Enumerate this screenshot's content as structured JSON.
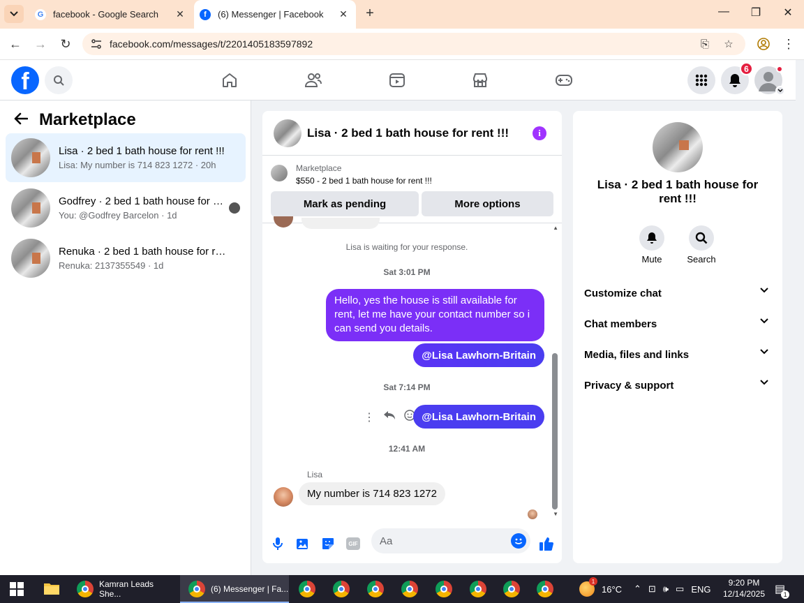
{
  "browser": {
    "tabs": [
      {
        "title": "facebook - Google Search",
        "icon": "google-icon"
      },
      {
        "title": "(6) Messenger | Facebook",
        "icon": "facebook-icon"
      }
    ],
    "url": "facebook.com/messages/t/2201405183597892"
  },
  "fb": {
    "logo_letter": "f",
    "notifications_count": "6"
  },
  "left": {
    "title": "Marketplace",
    "conversations": [
      {
        "name": "Lisa · 2 bed 1 bath house for rent !!!",
        "preview": "Lisa: My number is 714 823 1272 · 20h"
      },
      {
        "name": "Godfrey · 2 bed 1 bath house for rent !!!",
        "preview": "You: @Godfrey Barcelon · 1d"
      },
      {
        "name": "Renuka · 2 bed 1 bath house for rent !!!",
        "preview": "Renuka: 2137355549 · 1d"
      }
    ]
  },
  "chat": {
    "title": "Lisa · 2 bed 1 bath house for rent !!!",
    "info_glyph": "i",
    "listing_label": "Marketplace",
    "listing_title": "$550 - 2 bed 1 bath house for rent !!!",
    "mark_pending": "Mark as pending",
    "more_options": "More options",
    "waiting_text": "Lisa is waiting for your response.",
    "time1": "Sat 3:01 PM",
    "msg_out_1": "Hello, yes the house is still available for rent, let me have your contact number so i can send you details.",
    "msg_out_2": "@Lisa Lawhorn-Britain",
    "time2": "Sat 7:14 PM",
    "msg_out_3": "@Lisa Lawhorn-Britain",
    "time3": "12:41 AM",
    "sender_name": "Lisa",
    "msg_in_1": "My number is 714 823 1272",
    "composer_placeholder": "Aa",
    "gif_label": "GIF"
  },
  "right": {
    "name": "Lisa · 2 bed 1 bath house for rent !!!",
    "mute_label": "Mute",
    "search_label": "Search",
    "sections": [
      "Customize chat",
      "Chat members",
      "Media, files and links",
      "Privacy & support"
    ]
  },
  "taskbar": {
    "items": [
      {
        "label": "Kamran Leads She..."
      },
      {
        "label": "(6) Messenger | Fa..."
      }
    ],
    "weather_temp": "16°C",
    "weather_badge": "1",
    "language": "ENG",
    "time": "9:20 PM",
    "date": "12/14/2025",
    "notif_count": "1"
  },
  "colors": {
    "fb_blue": "#0866ff",
    "outgoing_bubble": "#7b2ff7",
    "mention_bubble": "#4a3df0",
    "active_conversation": "#e7f3ff",
    "tab_bar": "#fde3cf"
  }
}
